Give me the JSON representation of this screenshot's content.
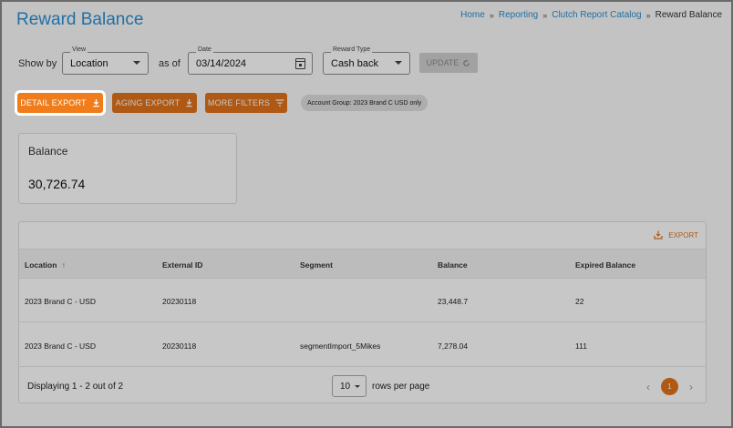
{
  "header": {
    "title": "Reward Balance",
    "breadcrumb": [
      "Home",
      "Reporting",
      "Clutch Report Catalog",
      "Reward Balance"
    ]
  },
  "filters": {
    "show_by_label": "Show by",
    "view_legend": "View",
    "view_value": "Location",
    "as_of_label": "as of",
    "date_legend": "Date",
    "date_value": "03/14/2024",
    "reward_type_legend": "Reward Type",
    "reward_type_value": "Cash back",
    "update_label": "UPDATE"
  },
  "actions": {
    "detail_export": "DETAIL EXPORT",
    "aging_export": "AGING EXPORT",
    "more_filters": "MORE FILTERS",
    "chip": "Account Group: 2023 Brand C USD only"
  },
  "balance": {
    "label": "Balance",
    "value": "30,726.74"
  },
  "table": {
    "export_label": "EXPORT",
    "columns": [
      "Location",
      "External ID",
      "Segment",
      "Balance",
      "Expired Balance"
    ],
    "rows": [
      [
        "2023 Brand C - USD",
        "20230118",
        "",
        "23,448.7",
        "22"
      ],
      [
        "2023 Brand C - USD",
        "20230118",
        "segmentImport_5Mikes",
        "7,278.04",
        "111"
      ]
    ],
    "sort_indicator": "↑",
    "footer": {
      "displaying": "Displaying 1 - 2 out of 2",
      "rows_per_page_value": "10",
      "rows_per_page_label": "rows per page",
      "current_page": "1"
    }
  },
  "colors": {
    "accent": "#e0731a",
    "title_blue": "#2b8fd2"
  }
}
